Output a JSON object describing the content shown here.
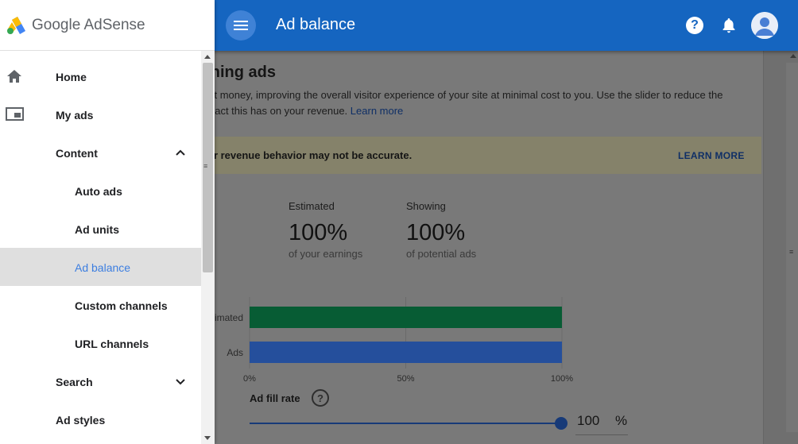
{
  "brand": {
    "name": "Google AdSense"
  },
  "topbar": {
    "title": "Ad balance",
    "help_glyph": "?"
  },
  "nav": {
    "items": [
      {
        "label": "Home",
        "icon": "home-icon",
        "level": "top"
      },
      {
        "label": "My ads",
        "icon": "ads-icon",
        "level": "top"
      },
      {
        "label": "Content",
        "level": "top",
        "expanded": true
      },
      {
        "label": "Auto ads",
        "level": "sub"
      },
      {
        "label": "Ad units",
        "level": "sub"
      },
      {
        "label": "Ad balance",
        "level": "sub",
        "active": true
      },
      {
        "label": "Custom channels",
        "level": "sub"
      },
      {
        "label": "URL channels",
        "level": "sub"
      },
      {
        "label": "Search",
        "level": "top",
        "expanded": false
      },
      {
        "label": "Ad styles",
        "level": "top"
      }
    ]
  },
  "main": {
    "heading": "ning ads",
    "desc_line1": "st money, improving the overall visitor experience of your site at minimal cost to you. Use the slider to reduce the",
    "desc_line2": "pact this has on your revenue.",
    "learn_more_link": "Learn more",
    "banner_text": "ur revenue behavior may not be accurate.",
    "banner_button": "LEARN MORE",
    "estimated": {
      "label": "Estimated",
      "value": "100%",
      "sub": "of your earnings"
    },
    "showing": {
      "label": "Showing",
      "value": "100%",
      "sub": "of potential ads"
    },
    "fill_rate": {
      "label": "Ad fill rate",
      "help_glyph": "?",
      "value": "100",
      "unit": "%",
      "level_percent": 100
    }
  },
  "chart_data": {
    "type": "bar",
    "orientation": "horizontal",
    "categories": [
      "imated",
      "Ads"
    ],
    "values": [
      100,
      100
    ],
    "colors": [
      "#075c34",
      "#254f9c"
    ],
    "xticks": [
      "0%",
      "50%",
      "100%"
    ],
    "xlim": [
      0,
      100
    ]
  },
  "colors": {
    "appbar": "#1565c0",
    "active_nav": "#3c7ee0",
    "slider": "#173a78"
  }
}
